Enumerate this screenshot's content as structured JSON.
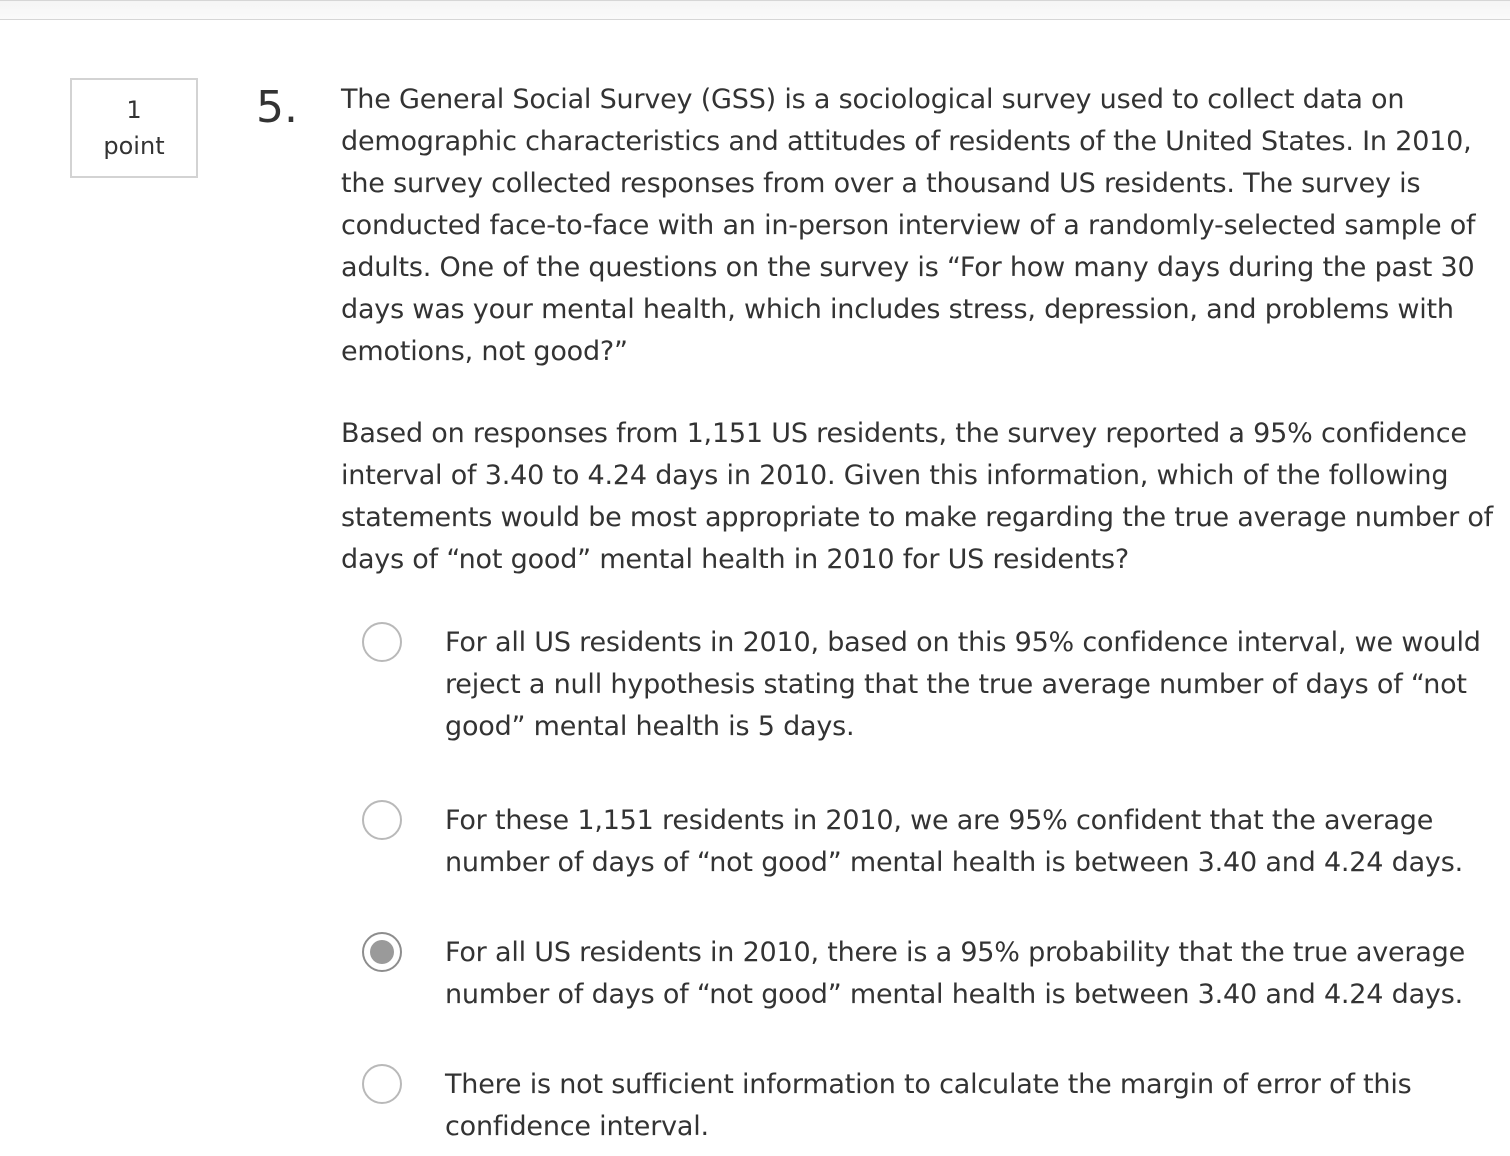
{
  "points": {
    "value": "1",
    "label": "point"
  },
  "question": {
    "number": "5.",
    "paragraphs": [
      "The General Social Survey (GSS) is a sociological survey used to collect data on demographic characteristics and attitudes of residents of the United States. In 2010, the survey collected responses from over a thousand US residents. The survey is conducted face-to-face with an in-person interview of a randomly-selected sample of adults. One of the questions on the survey is “For how many days during the past 30 days was your mental health, which includes stress, depression, and problems with emotions, not good?”",
      "Based on responses from 1,151 US residents, the survey reported a 95% confidence interval of 3.40 to 4.24 days in 2010. Given this information, which of the following statements would be most appropriate to make regarding the true average number of days of “not good” mental health in 2010 for US residents?"
    ]
  },
  "options": [
    {
      "text": "For all US residents in 2010, based on this 95% confidence interval, we would reject a null hypothesis stating that the true average number of days of “not good” mental health is 5 days.",
      "selected": false
    },
    {
      "text": "For these 1,151 residents in 2010, we are 95% confident that the average number of days of “not good” mental health is between 3.40 and 4.24 days.",
      "selected": false
    },
    {
      "text": "For all US residents in 2010, there is a 95% probability that the true average number of days of “not good” mental health is between 3.40 and 4.24 days.",
      "selected": true
    },
    {
      "text": "There is not sufficient information to calculate the margin of error of this confidence interval.",
      "selected": false
    }
  ]
}
